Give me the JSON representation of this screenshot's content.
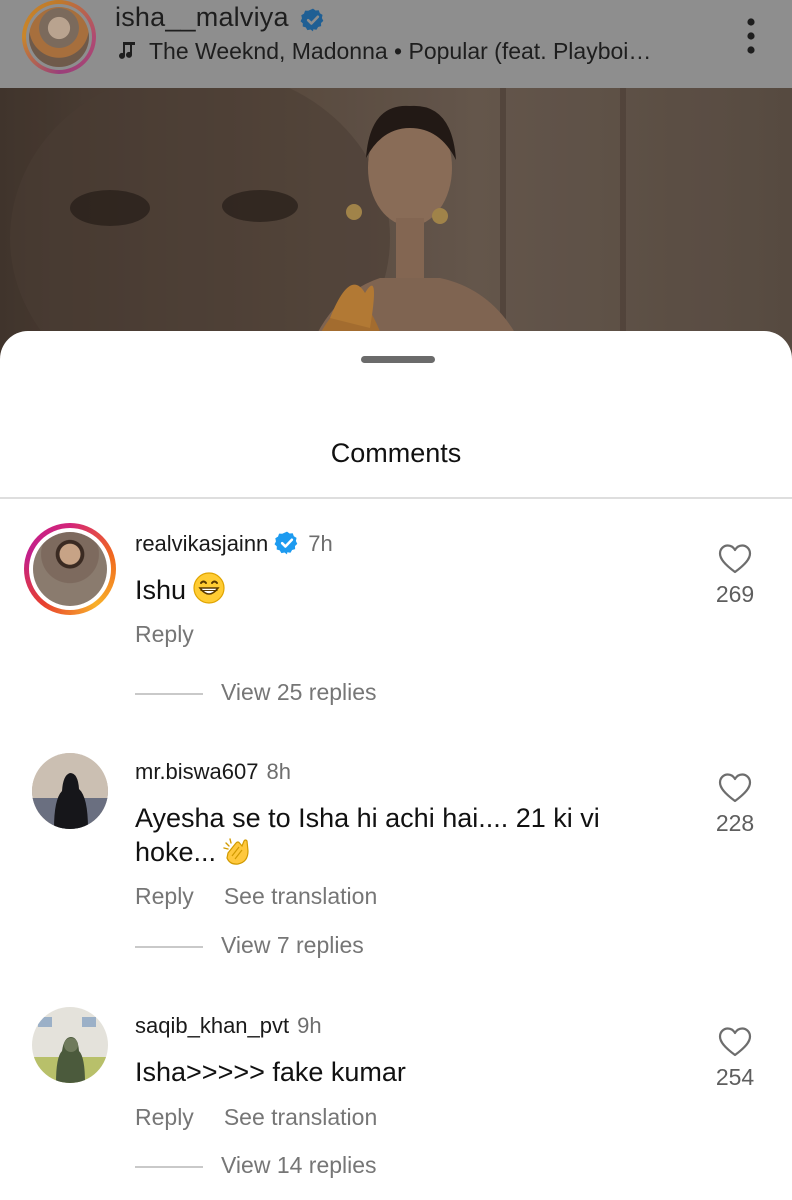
{
  "post": {
    "username": "isha__malviya",
    "music": "The Weeknd, Madonna • Popular (feat. Playboi…"
  },
  "sheet": {
    "title": "Comments"
  },
  "comments": [
    {
      "username": "realvikasjainn",
      "verified": true,
      "time": "7h",
      "text": "Ishu",
      "emoji": "grinning-face",
      "reply_label": "Reply",
      "likes": "269",
      "view_replies": "View 25 replies"
    },
    {
      "username": "mr.biswa607",
      "time": "8h",
      "text": "Ayesha se to Isha hi achi hai.... 21 ki vi hoke...",
      "emoji": "clapping-hands",
      "reply_label": "Reply",
      "translate_label": "See translation",
      "likes": "228",
      "view_replies": "View 7 replies"
    },
    {
      "username": "saqib_khan_pvt",
      "time": "9h",
      "text": "Isha>>>>> fake kumar",
      "reply_label": "Reply",
      "translate_label": "See translation",
      "likes": "254",
      "view_replies": "View 14 replies"
    }
  ],
  "colors": {
    "verified": "#1d9bf0",
    "story_ring_start": "#d3247a",
    "story_ring_end": "#f8b02a"
  }
}
